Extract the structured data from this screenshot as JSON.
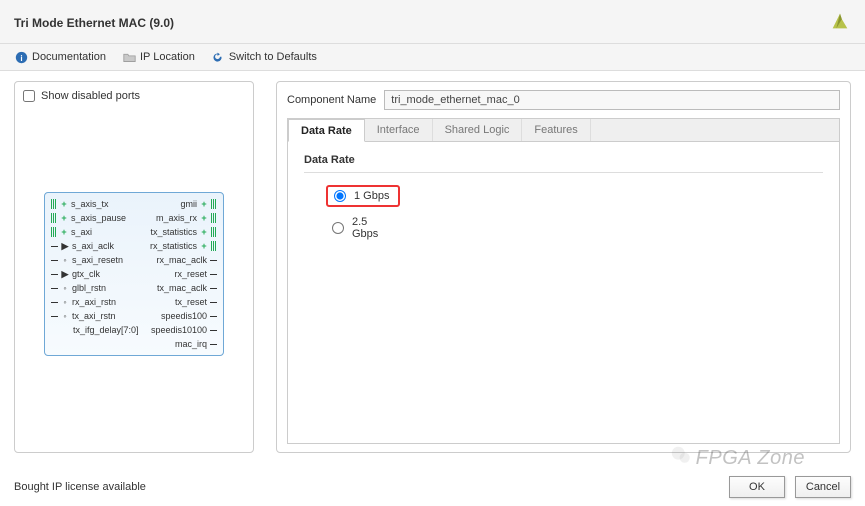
{
  "header": {
    "title": "Tri Mode Ethernet MAC (9.0)"
  },
  "toolbar": {
    "documentation": "Documentation",
    "ip_location": "IP Location",
    "switch_defaults": "Switch to Defaults"
  },
  "left_panel": {
    "show_disabled_label": "Show disabled ports",
    "ports_left": [
      "s_axis_tx",
      "s_axis_pause",
      "s_axi",
      "s_axi_aclk",
      "s_axi_resetn",
      "gtx_clk",
      "glbl_rstn",
      "rx_axi_rstn",
      "tx_axi_rstn",
      "tx_ifg_delay[7:0]"
    ],
    "ports_right": [
      "gmii",
      "m_axis_rx",
      "tx_statistics",
      "rx_statistics",
      "rx_mac_aclk",
      "rx_reset",
      "tx_mac_aclk",
      "tx_reset",
      "speedis100",
      "speedis10100",
      "mac_irq"
    ]
  },
  "right_panel": {
    "component_name_label": "Component Name",
    "component_name_value": "tri_mode_ethernet_mac_0",
    "tabs": [
      "Data Rate",
      "Interface",
      "Shared Logic",
      "Features"
    ],
    "active_tab": "Data Rate",
    "section_title": "Data Rate",
    "radio_options": [
      {
        "label": "1 Gbps",
        "selected": true,
        "highlight": true
      },
      {
        "label": "2.5 Gbps",
        "selected": false,
        "highlight": false
      }
    ]
  },
  "footer": {
    "note": "Bought IP license available",
    "ok": "OK",
    "cancel": "Cancel"
  },
  "watermark": "FPGA Zone"
}
